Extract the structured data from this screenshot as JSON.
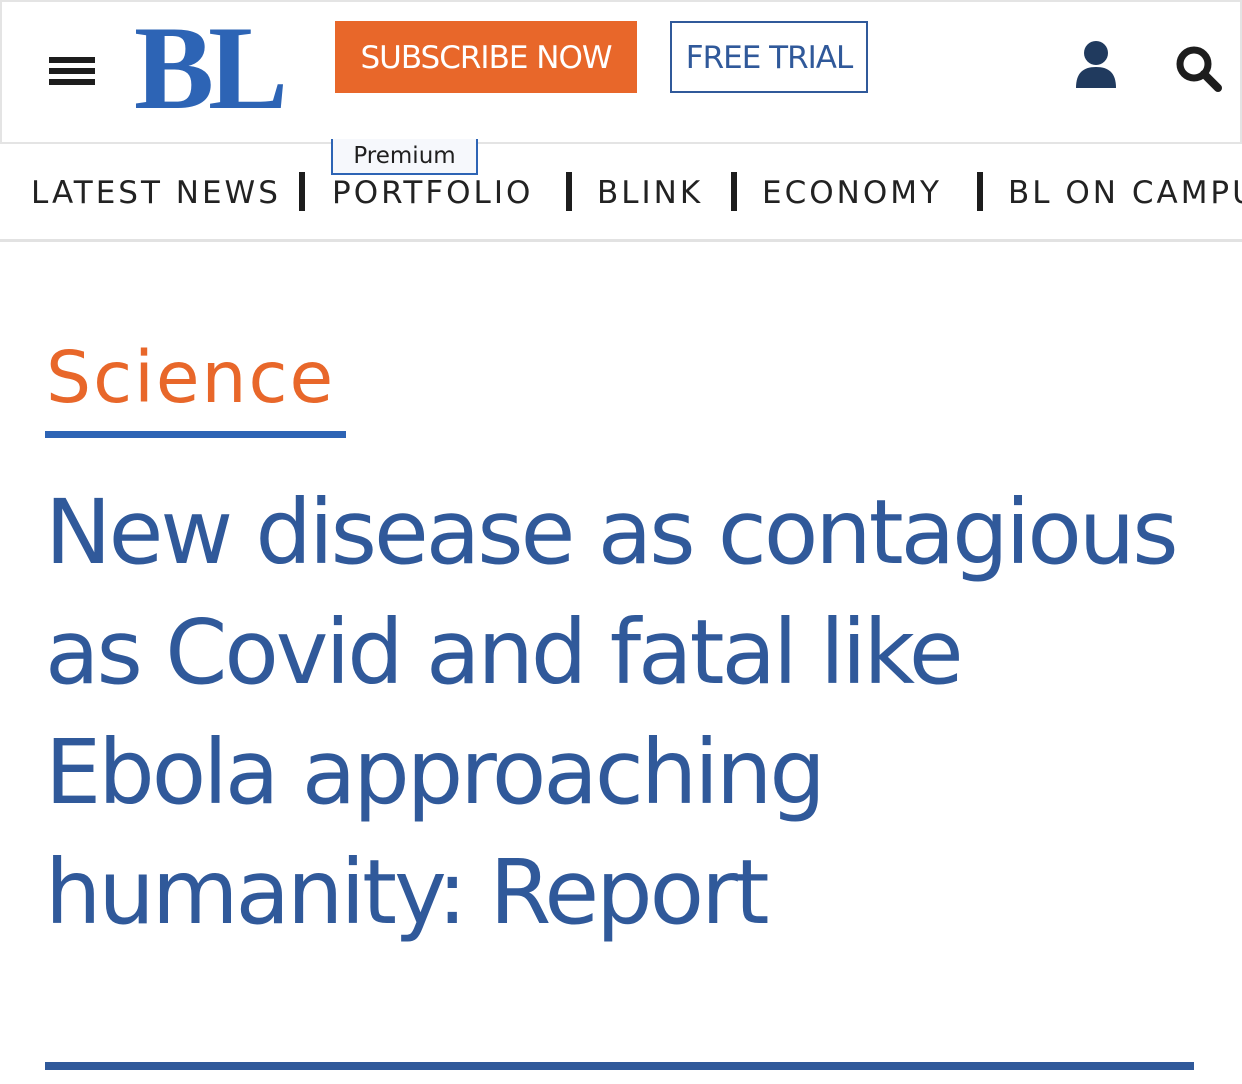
{
  "header": {
    "logo_text": "BL",
    "subscribe_label": "SUBSCRIBE NOW",
    "free_trial_label": "FREE TRIAL",
    "premium_label": "Premium",
    "icons": {
      "menu": "hamburger-menu-icon",
      "user": "user-icon",
      "search": "search-icon"
    }
  },
  "nav": {
    "items": [
      {
        "label": "LATEST NEWS"
      },
      {
        "label": "PORTFOLIO"
      },
      {
        "label": "BLINK"
      },
      {
        "label": "ECONOMY"
      },
      {
        "label": "BL ON CAMPU"
      }
    ]
  },
  "article": {
    "category": "Science",
    "headline": "New disease as contagious as Covid and fatal like Ebola approaching humanity: Report"
  },
  "colors": {
    "brand_blue": "#2d64b5",
    "headline_blue": "#30599a",
    "accent_orange": "#e8672a"
  }
}
